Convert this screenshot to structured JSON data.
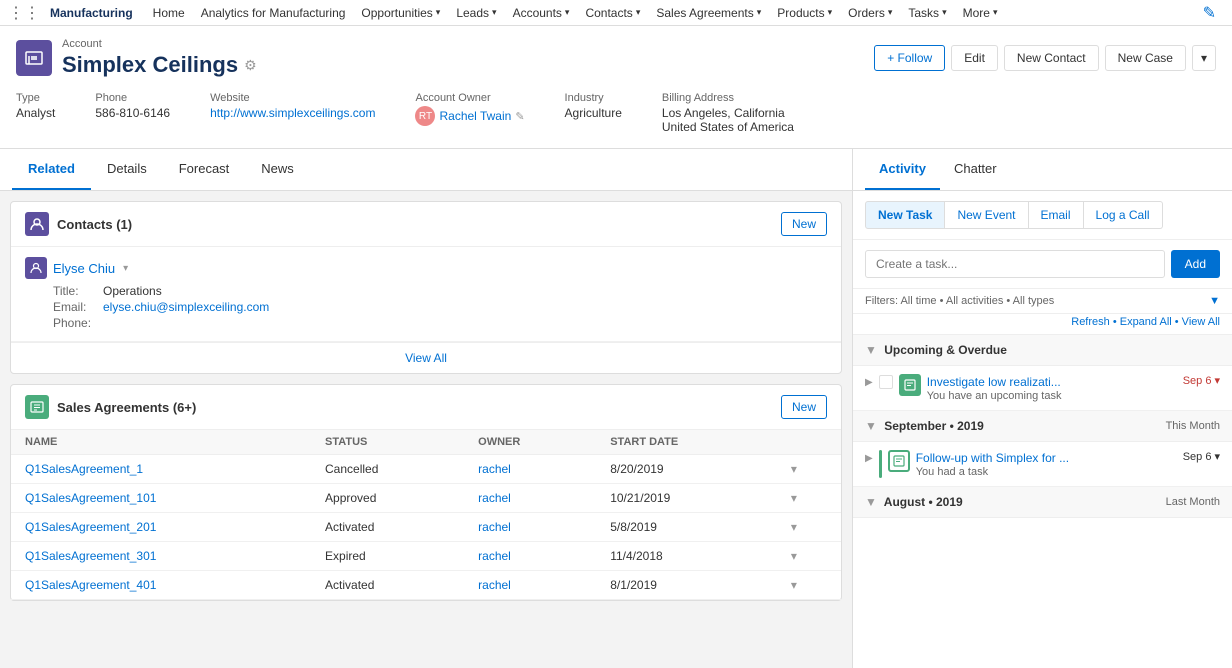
{
  "topNav": {
    "appGrid": "⋮⋮⋮",
    "appName": "Manufacturing",
    "items": [
      {
        "label": "Home",
        "hasDropdown": false
      },
      {
        "label": "Analytics for Manufacturing",
        "hasDropdown": false
      },
      {
        "label": "Opportunities",
        "hasDropdown": true
      },
      {
        "label": "Leads",
        "hasDropdown": true
      },
      {
        "label": "Accounts",
        "hasDropdown": true
      },
      {
        "label": "Contacts",
        "hasDropdown": true
      },
      {
        "label": "Sales Agreements",
        "hasDropdown": true
      },
      {
        "label": "Products",
        "hasDropdown": true
      },
      {
        "label": "Orders",
        "hasDropdown": true
      },
      {
        "label": "Tasks",
        "hasDropdown": true
      },
      {
        "label": "More",
        "hasDropdown": true
      }
    ],
    "editIcon": "✏️"
  },
  "account": {
    "label": "Account",
    "name": "Simplex Ceilings",
    "followLabel": "+ Follow",
    "editLabel": "Edit",
    "newContactLabel": "New Contact",
    "newCaseLabel": "New Case",
    "type_label": "Type",
    "type": "Analyst",
    "phone_label": "Phone",
    "phone": "586-810-6146",
    "website_label": "Website",
    "website": "http://www.simplexceilings.com",
    "owner_label": "Account Owner",
    "owner": "Rachel Twain",
    "industry_label": "Industry",
    "industry": "Agriculture",
    "billing_label": "Billing Address",
    "billing_line1": "Los Angeles, California",
    "billing_line2": "United States of America"
  },
  "leftTabs": [
    {
      "label": "Related",
      "active": true
    },
    {
      "label": "Details",
      "active": false
    },
    {
      "label": "Forecast",
      "active": false
    },
    {
      "label": "News",
      "active": false
    }
  ],
  "contacts": {
    "title": "Contacts (1)",
    "newLabel": "New",
    "items": [
      {
        "name": "Elyse Chiu",
        "title_label": "Title:",
        "title": "Operations",
        "email_label": "Email:",
        "email": "elyse.chiu@simplexceiling.com",
        "phone_label": "Phone:"
      }
    ],
    "viewAll": "View All"
  },
  "salesAgreements": {
    "title": "Sales Agreements (6+)",
    "newLabel": "New",
    "columns": [
      "NAME",
      "STATUS",
      "OWNER",
      "START DATE"
    ],
    "rows": [
      {
        "name": "Q1SalesAgreement_1",
        "status": "Cancelled",
        "owner": "rachel",
        "startDate": "8/20/2019"
      },
      {
        "name": "Q1SalesAgreement_101",
        "status": "Approved",
        "owner": "rachel",
        "startDate": "10/21/2019"
      },
      {
        "name": "Q1SalesAgreement_201",
        "status": "Activated",
        "owner": "rachel",
        "startDate": "5/8/2019"
      },
      {
        "name": "Q1SalesAgreement_301",
        "status": "Expired",
        "owner": "rachel",
        "startDate": "11/4/2018"
      },
      {
        "name": "Q1SalesAgreement_401",
        "status": "Activated",
        "owner": "rachel",
        "startDate": "8/1/2019"
      }
    ]
  },
  "rightTabs": [
    {
      "label": "Activity",
      "active": true
    },
    {
      "label": "Chatter",
      "active": false
    }
  ],
  "activity": {
    "buttons": [
      "New Task",
      "New Event",
      "Email",
      "Log a Call"
    ],
    "taskPlaceholder": "Create a task...",
    "addLabel": "Add",
    "filterText": "Filters: All time • All activities • All types",
    "filterLinks": "Refresh • Expand All • View All",
    "upcomingSection": "Upcoming & Overdue",
    "upcomingItems": [
      {
        "title": "Investigate low realizati...",
        "sub": "You have an upcoming task",
        "date": "Sep 6",
        "dateColor": "red"
      }
    ],
    "septemberSection": "September • 2019",
    "septemberBadge": "This Month",
    "septemberItems": [
      {
        "title": "Follow-up with Simplex for ...",
        "sub": "You had a task",
        "date": "Sep 6",
        "dateColor": "normal"
      }
    ],
    "augustSection": "August • 2019",
    "augustBadge": "Last Month"
  }
}
